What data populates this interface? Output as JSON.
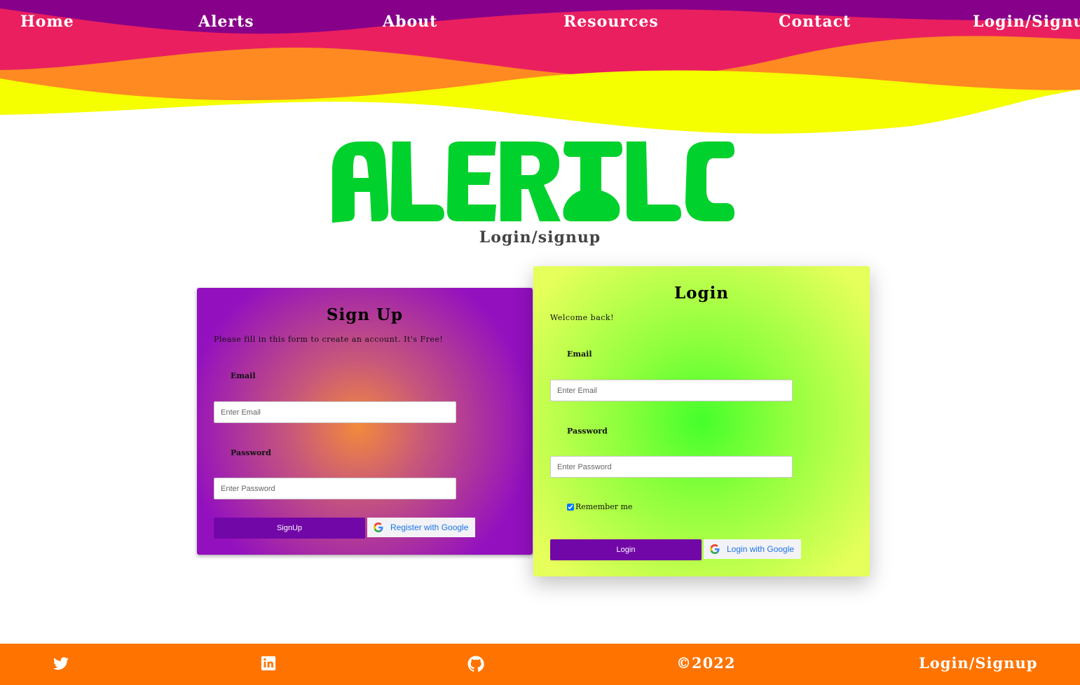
{
  "nav": {
    "items": [
      {
        "label": "Home"
      },
      {
        "label": "Alerts"
      },
      {
        "label": "About"
      },
      {
        "label": "Resources"
      },
      {
        "label": "Contact"
      },
      {
        "label": "Login/Signup"
      }
    ]
  },
  "brand": {
    "logo_text": "ALERTLE",
    "logo_color": "#00d12d",
    "page_subtitle": "Login/signup"
  },
  "signup": {
    "title": "Sign Up",
    "description": "Please fill in this form to create an account. It's Free!",
    "email_label": "Email",
    "email_placeholder": "Enter Email",
    "password_label": "Password",
    "password_placeholder": "Enter Password",
    "submit_label": "SignUp",
    "google_label": "Register with Google"
  },
  "login": {
    "title": "Login",
    "description": "Welcome back!",
    "email_label": "Email",
    "email_placeholder": "Enter Email",
    "password_label": "Password",
    "password_placeholder": "Enter Password",
    "remember_label": "Remember me",
    "remember_checked": true,
    "submit_label": "Login",
    "google_label": "Login with Google"
  },
  "footer": {
    "icons": [
      "twitter-icon",
      "linkedin-icon",
      "github-icon"
    ],
    "copyright": "©2022",
    "login_link": "Login/Signup"
  },
  "colors": {
    "wave_purple": "#870089",
    "wave_pink": "#ea1f60",
    "wave_orange": "#ff8a22",
    "wave_yellow": "#f5ff00",
    "button_purple": "#7207a7",
    "footer_orange": "#ff7300"
  }
}
